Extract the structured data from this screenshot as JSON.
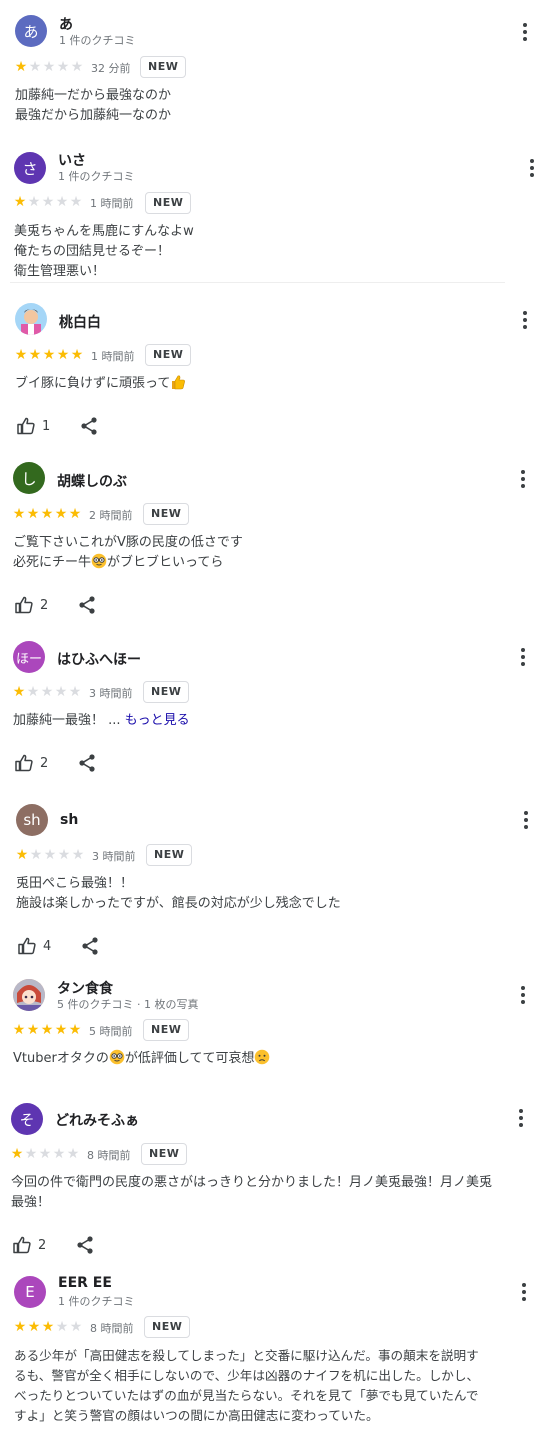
{
  "reviews": [
    {
      "initial": "あ",
      "avatar_color": "#5c6bc0",
      "name": "あ",
      "count": "1 件のクチコミ",
      "rating": 1,
      "time": "32 分前",
      "badge": "NEW",
      "text": "加藤純一だから最強なのか\n最強だから加藤純一なのか"
    },
    {
      "initial": "さ",
      "avatar_color": "#5e35b1",
      "name": "いさ",
      "count": "1 件のクチコミ",
      "rating": 1,
      "time": "1 時間前",
      "badge": "NEW",
      "text": "美兎ちゃんを馬鹿にすんなよw\n俺たちの団結見せるぞー！\n衛生管理悪い！"
    },
    {
      "initial": "",
      "avatar_color": "#a5d6f7",
      "name": "桃白白",
      "count": "",
      "rating": 5,
      "time": "1 時間前",
      "badge": "NEW",
      "text": "ブイ豚に負けずに頑張って",
      "likes": "1"
    },
    {
      "initial": "し",
      "avatar_color": "#33691e",
      "name": "胡蝶しのぶ",
      "count": "",
      "rating": 5,
      "time": "2 時間前",
      "badge": "NEW",
      "text_a": "ご覧下さいこれがV豚の民度の低さです\n必死にチー牛",
      "text_b": "がブヒブヒいってら",
      "likes": "2"
    },
    {
      "initial": "ほー",
      "avatar_color": "#ab47bc",
      "name": "はひふへほー",
      "count": "",
      "rating": 1,
      "time": "3 時間前",
      "badge": "NEW",
      "text": "加藤純一最強！ ...",
      "more": "もっと見る",
      "likes": "2"
    },
    {
      "initial": "sh",
      "avatar_color": "#8d6e63",
      "name": "sh",
      "count": "",
      "rating": 1,
      "time": "3 時間前",
      "badge": "NEW",
      "text": "兎田ぺこら最強！！\n施設は楽しかったですが、館長の対応が少し残念でした",
      "likes": "4"
    },
    {
      "initial": "",
      "avatar_color": "#f4a97b",
      "name": "タン食食",
      "count": "5 件のクチコミ · 1 枚の写真",
      "rating": 5,
      "time": "5 時間前",
      "badge": "NEW",
      "text_a": "Vtuberオタクの",
      "text_b": "が低評価してて可哀想"
    },
    {
      "initial": "そ",
      "avatar_color": "#5e35b1",
      "name": "どれみそふぁ",
      "count": "",
      "rating": 1,
      "time": "8 時間前",
      "badge": "NEW",
      "text": "今回の件で衛門の民度の悪さがはっきりと分かりました！月ノ美兎最強！月ノ美兎\n最強！",
      "likes": "2"
    },
    {
      "initial": "E",
      "avatar_color": "#ab47bc",
      "name": "EER EE",
      "count": "1 件のクチコミ",
      "rating": 3,
      "time": "8 時間前",
      "badge": "NEW",
      "text": "ある少年が「高田健志を殺してしまった」と交番に駆け込んだ。事の顛末を説明す\nるも、警官が全く相手にしないので、少年は凶器のナイフを机に出した。しかし、\nべったりとついていたはずの血が見当たらない。それを見て「夢でも見ていたんで\nすよ」と笑う警官の顔はいつの間にか高田健志に変わっていた。"
    }
  ]
}
